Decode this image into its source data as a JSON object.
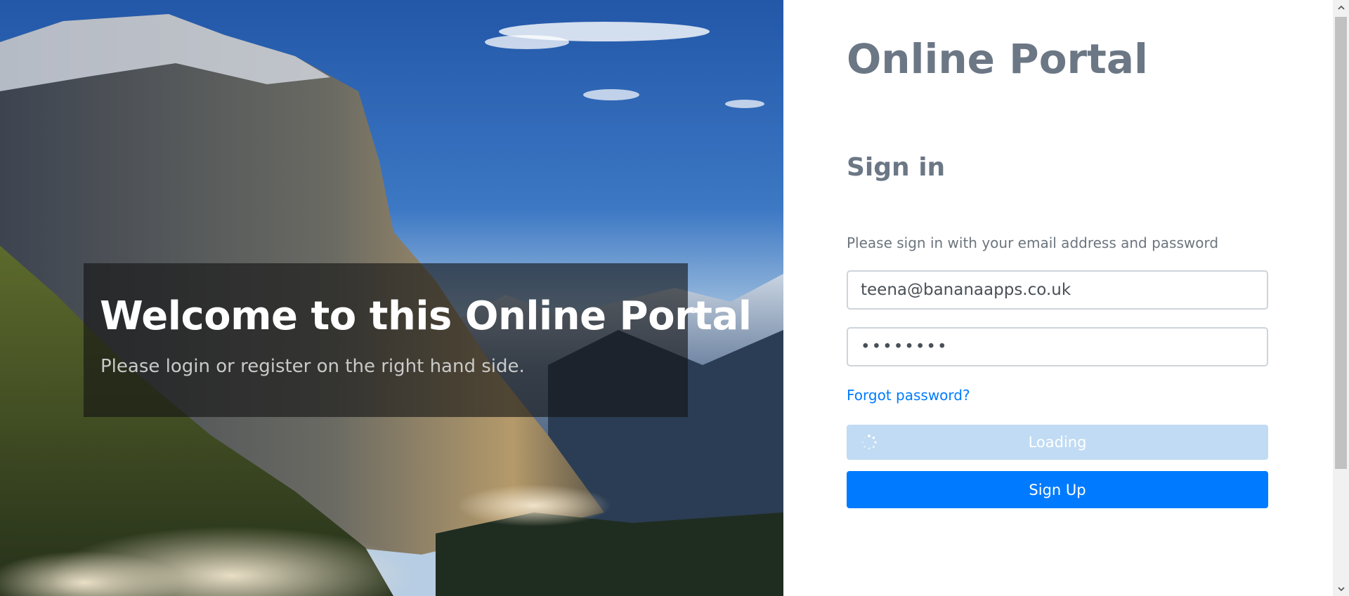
{
  "hero": {
    "title": "Welcome to this Online Portal",
    "subtitle": "Please login or register on the right hand side."
  },
  "form": {
    "brand": "Online Portal",
    "heading": "Sign in",
    "instructions": "Please sign in with your email address and password",
    "email_value": "teena@bananaapps.co.uk",
    "password_value": "••••••••",
    "forgot_password_label": "Forgot password?",
    "loading_label": "Loading",
    "signup_label": "Sign Up"
  },
  "icons": {
    "spinner": "loading-spinner-icon",
    "scroll_up": "chevron-up-icon",
    "scroll_down": "chevron-down-icon"
  },
  "colors": {
    "accent": "#007bff",
    "loading_button": "#c0dbf3",
    "muted_text": "#6c757d",
    "brand_text": "#6c7785"
  }
}
